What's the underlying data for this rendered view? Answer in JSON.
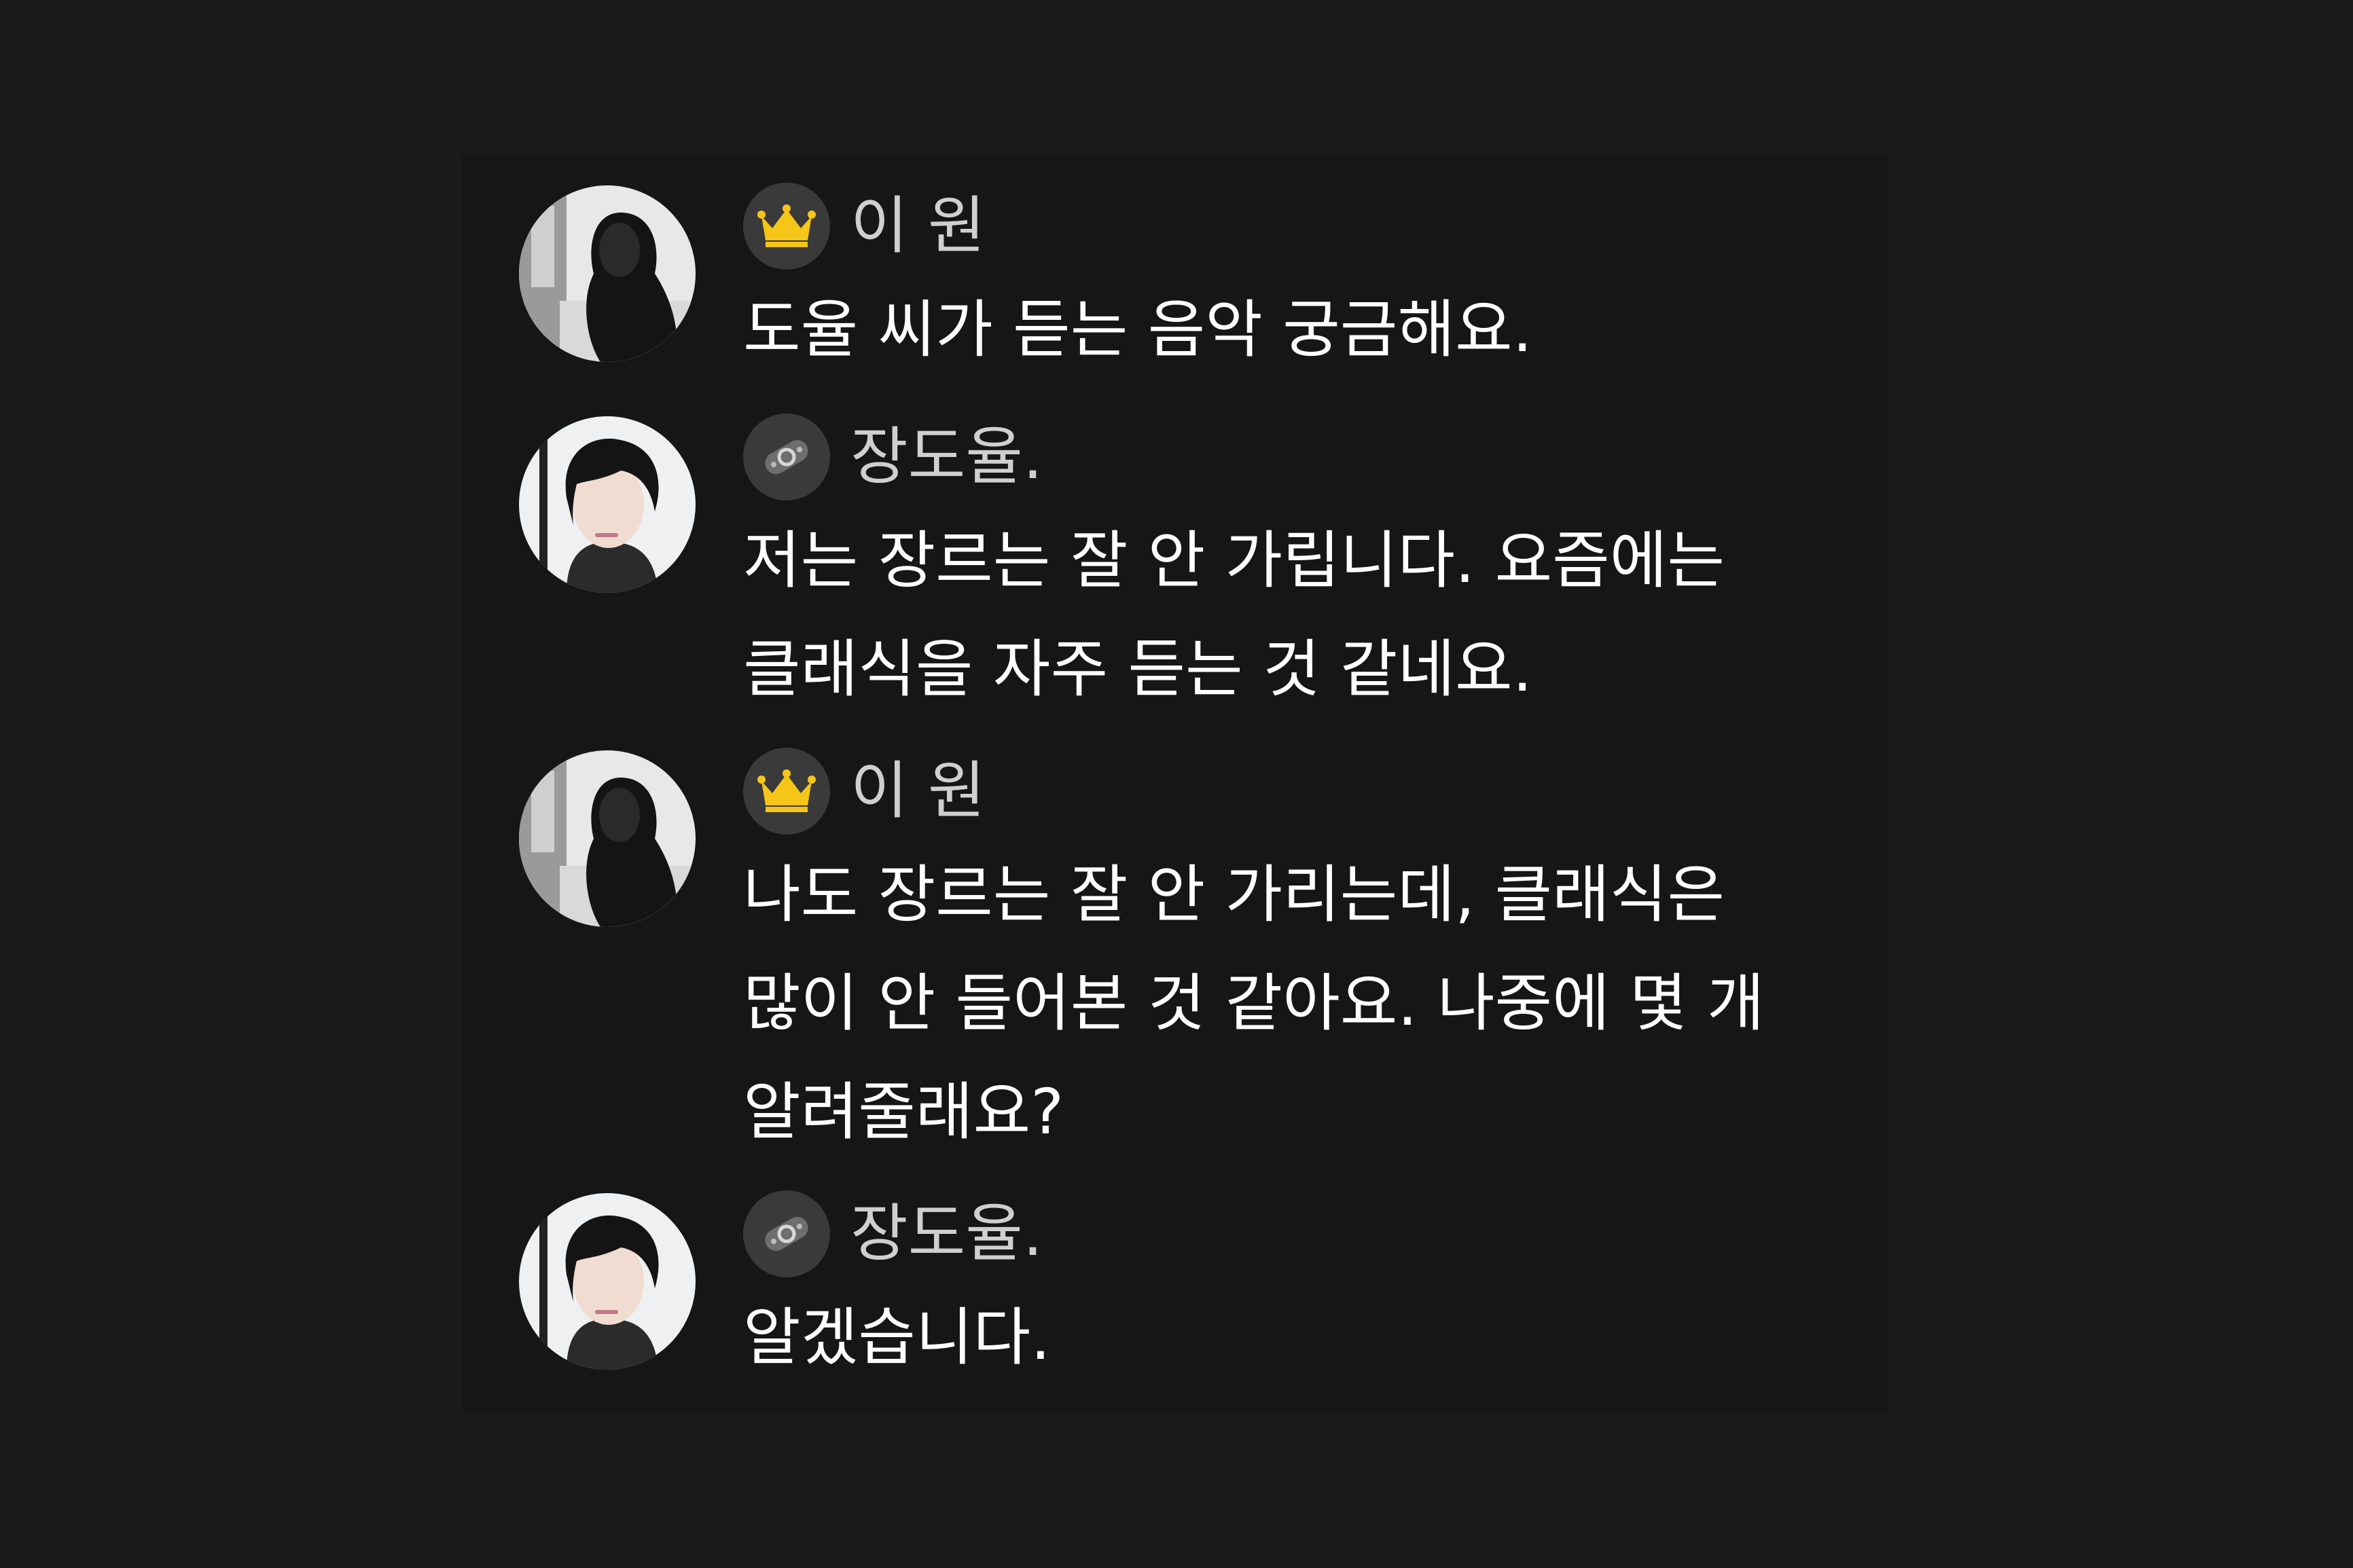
{
  "messages": [
    {
      "speaker": "이 원",
      "badge_icon": "crown-icon",
      "avatar": "woman-avatar",
      "lines": [
        "도율 씨가 듣는 음악 궁금해요."
      ]
    },
    {
      "speaker": "장도율.",
      "badge_icon": "ring-icon",
      "avatar": "man-avatar",
      "lines": [
        "저는 장르는 잘 안 가립니다. 요즘에는",
        "클래식을 자주 듣는 것 같네요."
      ]
    },
    {
      "speaker": "이 원",
      "badge_icon": "crown-icon",
      "avatar": "woman-avatar",
      "lines": [
        "나도 장르는 잘 안 가리는데, 클래식은",
        "많이 안 들어본 것 같아요. 나중에 몇 개",
        "알려줄래요?"
      ]
    },
    {
      "speaker": "장도율.",
      "badge_icon": "ring-icon",
      "avatar": "man-avatar",
      "lines": [
        "알겠습니다."
      ]
    }
  ],
  "colors": {
    "background": "#1a1a1a",
    "badge_bg": "#3a3a3a",
    "crown": "#f5c518",
    "name": "#cfcfcf",
    "text": "#ffffff"
  }
}
